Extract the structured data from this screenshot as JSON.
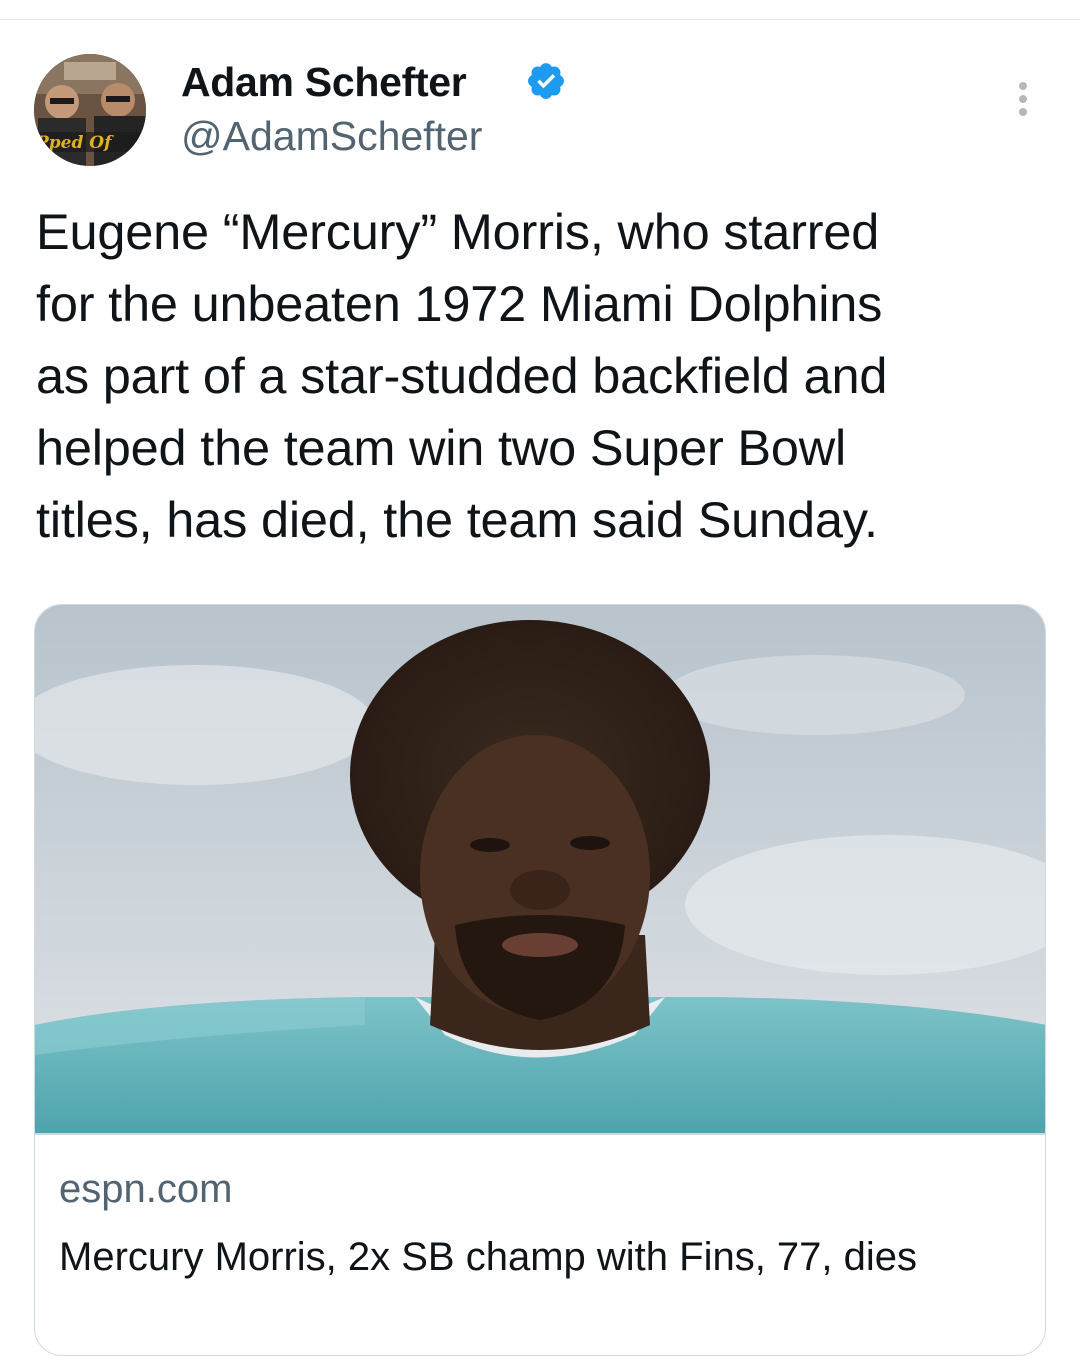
{
  "tweet": {
    "author_name": "Adam Schefter",
    "handle": "@AdamSchefter",
    "verified": true,
    "avatar_caption": "Pped Of",
    "text": "Eugene “Mercury” Morris, who starred\nfor the unbeaten 1972 Miami Dolphins\nas part of a star-studded backfield and\nhelped the team win two Super Bowl\ntitles, has died, the team said Sunday."
  },
  "card": {
    "domain": "espn.com",
    "title": "Mercury Morris, 2x SB champ with Fins, 77, dies",
    "image_subject": "photo-of-player-in-aqua-jersey"
  },
  "icons": {
    "verified": "verified-badge-icon",
    "more": "more-options-icon"
  },
  "colors": {
    "verified_blue": "#1d9bf0",
    "secondary_text": "#536471",
    "jersey_aqua": "#5fb0b7"
  }
}
